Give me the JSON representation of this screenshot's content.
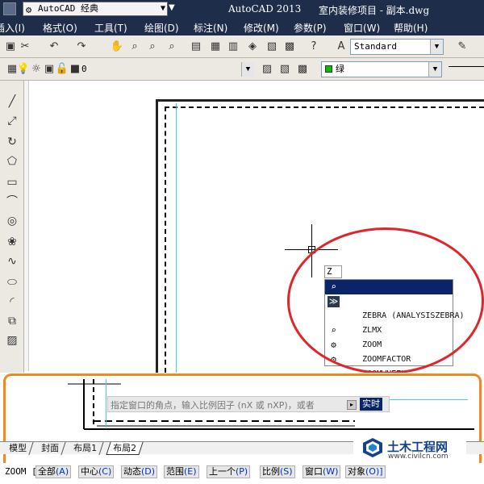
{
  "window": {
    "workspace": "AutoCAD 经典",
    "app_title": "AutoCAD 2013",
    "doc_title": "室内装修项目 - 副本.dwg"
  },
  "menu": [
    "插入(I)",
    "格式(O)",
    "工具(T)",
    "绘图(D)",
    "标注(N)",
    "修改(M)",
    "参数(P)",
    "窗口(W)",
    "帮助(H)"
  ],
  "toolbar": {
    "text_style": "Standard",
    "layer_value": "0",
    "color_value": "绿"
  },
  "autocomplete": {
    "input": "Z",
    "items": [
      {
        "label": "Z (ZOOM)",
        "icon": "zoom-icon",
        "selected": true
      },
      {
        "label": "ZEBRA (ANALYSISZEBRA)",
        "icon": "zebra-icon",
        "selected": false
      },
      {
        "label": "ZLMX",
        "icon": "",
        "selected": false
      },
      {
        "label": "ZOOM",
        "icon": "zoom-clock-icon",
        "selected": false
      },
      {
        "label": "ZOOMFACTOR",
        "icon": "gear-icon",
        "selected": false
      },
      {
        "label": "ZOOMWHEEL",
        "icon": "gear-icon",
        "selected": false
      }
    ]
  },
  "prompt": {
    "text": "指定窗口的角点，输入比例因子 (nX 或 nXP)，或者",
    "option": "实时"
  },
  "tabs": [
    {
      "label": "模型",
      "active": false
    },
    {
      "label": "封面",
      "active": false
    },
    {
      "label": "布局1",
      "active": false
    },
    {
      "label": "布局2",
      "active": true
    }
  ],
  "command_line": {
    "command": "ZOOM [",
    "options": [
      {
        "label": "全部",
        "key": "(A)"
      },
      {
        "label": "中心",
        "key": "(C)"
      },
      {
        "label": "动态",
        "key": "(D)"
      },
      {
        "label": "范围",
        "key": "(E)"
      },
      {
        "label": "上一个",
        "key": "(P)"
      },
      {
        "label": "比例",
        "key": "(S)"
      },
      {
        "label": "窗口",
        "key": "(W)"
      },
      {
        "label": "对象",
        "key": "(O)]"
      }
    ]
  },
  "watermark": {
    "name": "土木工程网",
    "url": "www.civilcn.com"
  },
  "colors": {
    "title_bar": "#1d2d4a",
    "selection": "#0a246a",
    "annotation_red": "#e0262a",
    "annotation_orange": "#f08a1e",
    "guide_cyan": "#3fd0e0",
    "layer_green": "#00c000"
  }
}
